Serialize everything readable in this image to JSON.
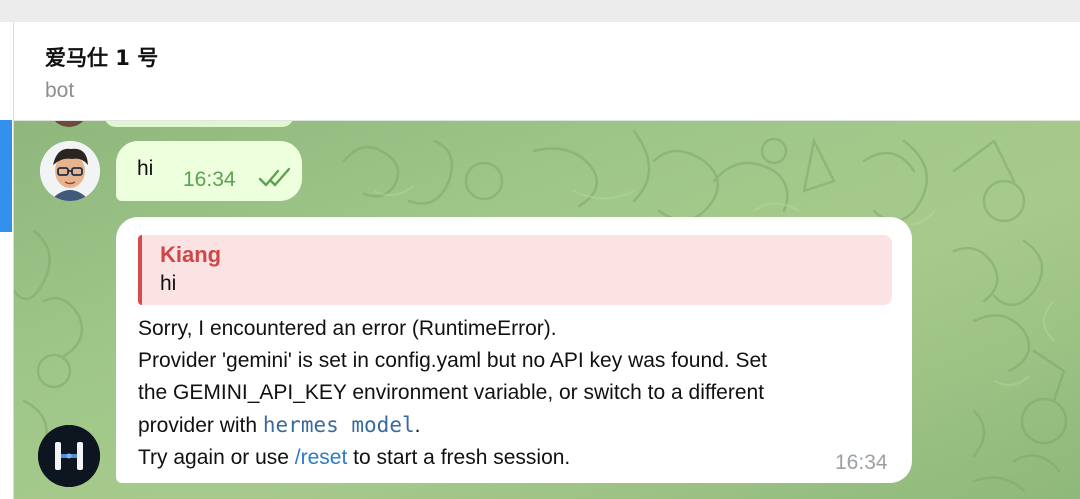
{
  "chat": {
    "title": "爱马仕 1 号",
    "subtitle": "bot"
  },
  "outgoing_message": {
    "text": "hi",
    "time": "16:34",
    "status_icon": "double-check-icon"
  },
  "incoming_message": {
    "reply_to": {
      "author": "Kiang",
      "text": "hi"
    },
    "line1": "Sorry, I encountered an error (RuntimeError).",
    "line2": "Provider 'gemini' is set in config.yaml but no API key was found. Set",
    "line3": "the GEMINI_API_KEY environment variable, or switch to a different",
    "line4_prefix": "provider with ",
    "line4_code": "hermes model",
    "line4_suffix": ".",
    "line5_prefix": "Try again or use ",
    "line5_command": "/reset",
    "line5_suffix": " to start a fresh session.",
    "time": "16:34"
  },
  "colors": {
    "outgoing_bubble": "#eeffde",
    "time_green": "#5aa24f",
    "reply_accent": "#d94b4b",
    "command_link": "#2d7bc7",
    "accent_blue": "#3390ec"
  }
}
